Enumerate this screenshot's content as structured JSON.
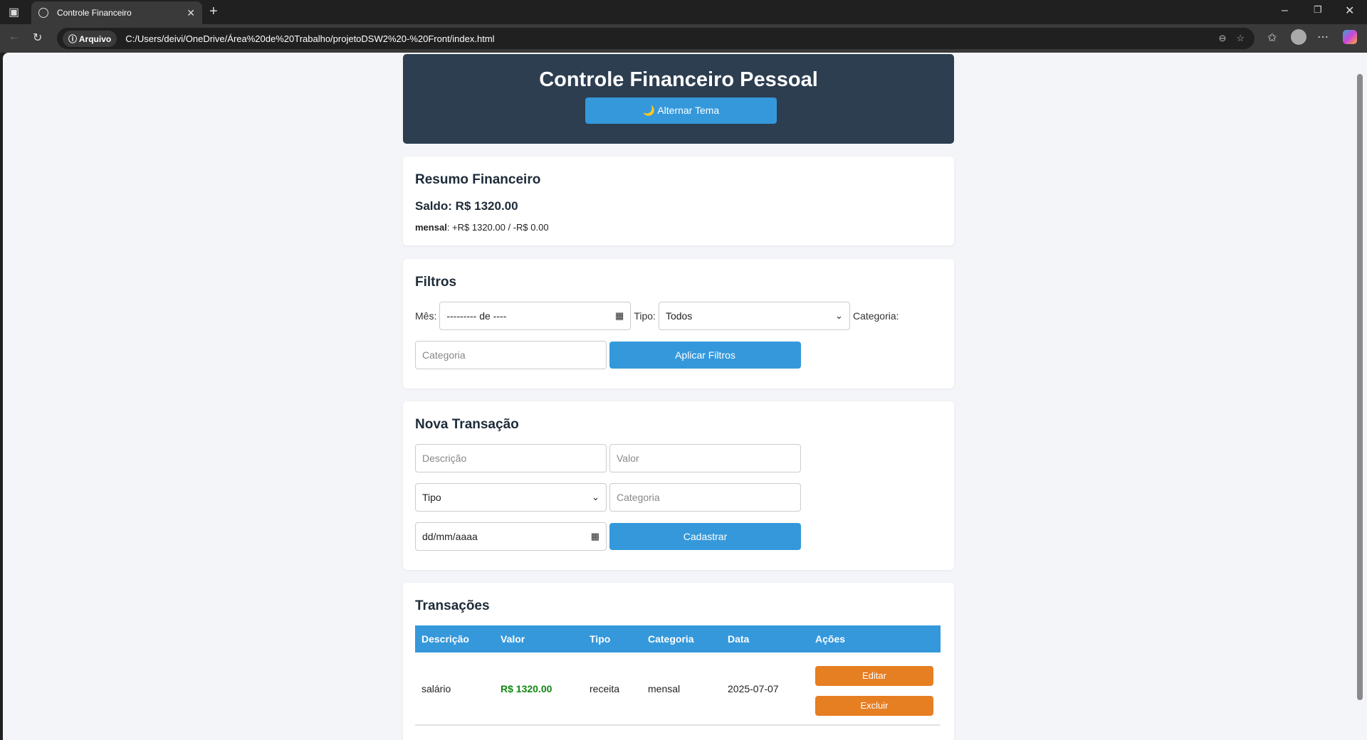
{
  "browser": {
    "tab_title": "Controle Financeiro",
    "address_label": "Arquivo",
    "url": "C:/Users/deivi/OneDrive/Área%20de%20Trabalho/projetoDSW2%20-%20Front/index.html"
  },
  "header": {
    "title": "Controle Financeiro Pessoal",
    "theme_button": "🌙 Alternar Tema"
  },
  "summary": {
    "title": "Resumo Financeiro",
    "balance": "Saldo: R$ 1320.00",
    "category_label": "mensal",
    "category_values": ": +R$ 1320.00 / -R$ 0.00"
  },
  "filters": {
    "title": "Filtros",
    "month_label": "Mês:",
    "month_value": "--------- de ----",
    "type_label": "Tipo:",
    "type_value": "Todos",
    "category_label": "Categoria:",
    "category_placeholder": "Categoria",
    "apply_button": "Aplicar Filtros"
  },
  "new_transaction": {
    "title": "Nova Transação",
    "description_placeholder": "Descrição",
    "value_placeholder": "Valor",
    "type_value": "Tipo",
    "category_placeholder": "Categoria",
    "date_placeholder": "dd/mm/aaaa",
    "submit_button": "Cadastrar"
  },
  "transactions": {
    "title": "Transações",
    "columns": [
      "Descrição",
      "Valor",
      "Tipo",
      "Categoria",
      "Data",
      "Ações"
    ],
    "rows": [
      {
        "description": "salário",
        "value": "R$ 1320.00",
        "type": "receita",
        "category": "mensal",
        "date": "2025-07-07",
        "edit": "Editar",
        "delete": "Excluir"
      }
    ]
  }
}
